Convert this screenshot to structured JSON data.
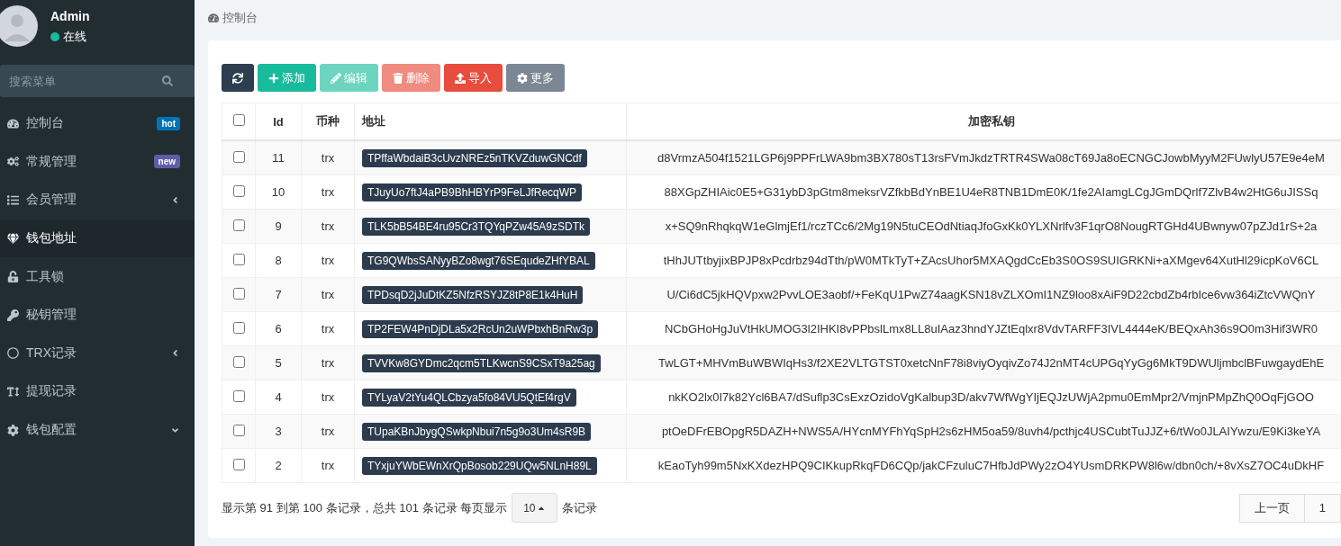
{
  "user": {
    "name": "Admin",
    "status": "在线"
  },
  "search": {
    "placeholder": "搜索菜单"
  },
  "sidebar": {
    "items": [
      {
        "label": "控制台",
        "selected": false,
        "badge": {
          "text": "hot",
          "color": "#0073b7"
        }
      },
      {
        "label": "常规管理",
        "selected": false,
        "badge": {
          "text": "new",
          "color": "#605ca8"
        }
      },
      {
        "label": "会员管理",
        "selected": false,
        "expanded": false
      },
      {
        "label": "钱包地址",
        "selected": true
      },
      {
        "label": "工具锁",
        "selected": false
      },
      {
        "label": "秘钥管理",
        "selected": false
      },
      {
        "label": "TRX记录",
        "selected": false,
        "expanded": false
      },
      {
        "label": "提现记录",
        "selected": false
      },
      {
        "label": "钱包配置",
        "selected": false,
        "expanded": true
      }
    ]
  },
  "breadcrumb": "控制台",
  "toolbar": [
    {
      "kind": "refresh",
      "color": "#2c3e50"
    },
    {
      "kind": "add",
      "label": "添加",
      "color": "#18bc9c"
    },
    {
      "kind": "edit",
      "label": "编辑",
      "color": "#6dd5bf"
    },
    {
      "kind": "delete",
      "label": "删除",
      "color": "#f08b80"
    },
    {
      "kind": "import",
      "label": "导入",
      "color": "#e74c3c"
    },
    {
      "kind": "more",
      "label": "更多",
      "color": "#7b8794"
    }
  ],
  "table": {
    "columns": [
      "Id",
      "币种",
      "地址",
      "加密私钥"
    ],
    "all_checked": false,
    "rows": [
      {
        "checked": false,
        "id": "11",
        "coin": "trx",
        "address": "TPffaWbdaiB3cUvzNREz5nTKVZduwGNCdf",
        "key": "d8VrmzA504f1521LGP6j9PPFrLWA9bm3BX780sT13rsFVmJkdzTRTR4SWa08cT69Ja8oECNGCJowbMyyM2FUwlyU57E9e4eM"
      },
      {
        "checked": false,
        "id": "10",
        "coin": "trx",
        "address": "TJuyUo7ftJ4aPB9BhHBYrP9FeLJfRecqWP",
        "key": "88XGpZHIAic0E5+G31ybD3pGtm8meksrVZfkbBdYnBE1U4eR8TNB1DmE0K/1fe2AIamgLCgJGmDQrlf7ZlvB4w2HtG6uJISSq"
      },
      {
        "checked": false,
        "id": "9",
        "coin": "trx",
        "address": "TLK5bB54BE4ru95Cr3TQYqPZw45A9zSDTk",
        "key": "x+SQ9nRhqkqW1eGlmjEf1/rczTCc6/2Mg19N5tuCEOdNtiaqJfoGxKk0YLXNrlfv3F1qrO8NougRTGHd4UBwnyw07pZJd1rS+2a"
      },
      {
        "checked": false,
        "id": "8",
        "coin": "trx",
        "address": "TG9QWbsSANyyBZo8wgt76SEqudeZHfYBAL",
        "key": "tHhJUTtbyjixBPJP8xPcdrbz94dTth/pW0MTkTyT+ZAcsUhor5MXAQgdCcEb3S0OS9SUIGRKNi+aXMgev64XutHl29icpKoV6CL"
      },
      {
        "checked": false,
        "id": "7",
        "coin": "trx",
        "address": "TPDsqD2jJuDtKZ5NfzRSYJZ8tP8E1k4HuH",
        "key": "U/Ci6dC5jkHQVpxw2PvvLOE3aobf/+FeKqU1PwZ74aagKSN18vZLXOmI1NZ9loo8xAiF9D22cbdZb4rbIce6vw364iZtcVWQnY"
      },
      {
        "checked": false,
        "id": "6",
        "coin": "trx",
        "address": "TP2FEW4PnDjDLa5x2RcUn2uWPbxhBnRw3p",
        "key": "NCbGHoHgJuVtHkUMOG3l2IHKI8vPPbslLmx8LL8uIAaz3hndYJZtEqlxr8VdvTARFF3IVL4444eK/BEQxAh36s9O0m3Hif3WR0"
      },
      {
        "checked": false,
        "id": "5",
        "coin": "trx",
        "address": "TVVKw8GYDmc2qcm5TLKwcnS9CSxT9a25ag",
        "key": "TwLGT+MHVmBuWBWIqHs3/f2XE2VLTGTST0xetcNnF78i8viyOyqivZo74J2nMT4cUPGqYyGg6MkT9DWUljmbclBFuwgaydEhE"
      },
      {
        "checked": false,
        "id": "4",
        "coin": "trx",
        "address": "TYLyaV2tYu4QLCbzya5fo84VU5QtEf4rgV",
        "key": "nkKO2lx0I7k82Ycl6BA7/dSuflp3CsExzOzidoVgKalbup3D/akv7WfWgYIjEQJzUWjA2pmu0EmMpr2/VmjnPMpZhQ0OqFjGOO"
      },
      {
        "checked": false,
        "id": "3",
        "coin": "trx",
        "address": "TUpaKBnJbygQSwkpNbui7n5g9o3Um4sR9B",
        "key": "ptOeDFrEBOpgR5DAZH+NWS5A/HYcnMYFhYqSpH2s6zHM5oa59/8uvh4/pcthjc4USCubtTuJJZ+6/tWo0JLAIYwzu/E9Ki3keYA"
      },
      {
        "checked": false,
        "id": "2",
        "coin": "trx",
        "address": "TYxjuYWbEWnXrQpBosob229UQw5NLnH89L",
        "key": "kEaoTyh99m5NxKXdezHPQ9CIKkupRkqFD6CQp/jakCFzuluC7HfbJdPWy2zO4YUsmDRKPW8l6w/dbn0ch/+8vXsZ7OC4uDkHF"
      }
    ]
  },
  "footer": {
    "summary": "显示第 91 到第 100 条记录，总共 101 条记录 每页显示",
    "page_size": "10",
    "suffix": "条记录"
  },
  "pagination": [
    {
      "label": "上一页"
    },
    {
      "label": "1"
    }
  ]
}
